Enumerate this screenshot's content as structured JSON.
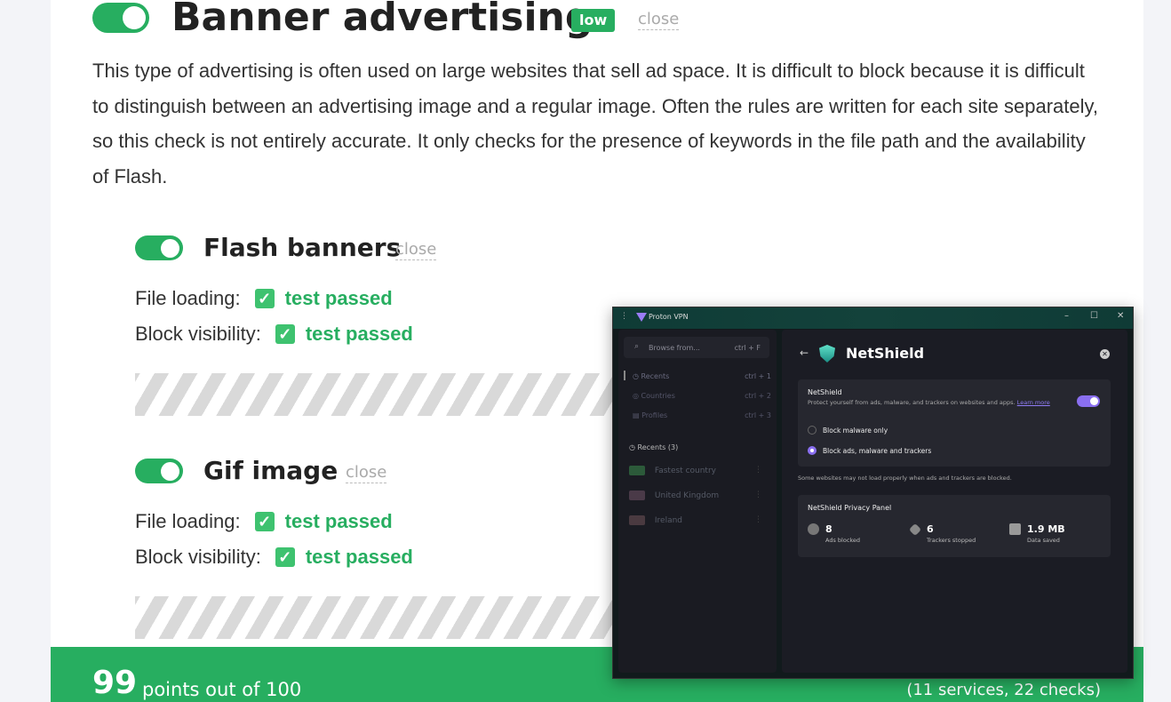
{
  "section": {
    "title": "Banner advertising",
    "badge": "low",
    "close_label": "close",
    "description": "This type of advertising is often used on large websites that sell ad space. It is difficult to block because it is difficult to distinguish between an advertising image and a regular image. Often the rules are written for each site separately, so this check is not entirely accurate. It only checks for the presence of keywords in the file path and the availability of Flash."
  },
  "tests": [
    {
      "title": "Flash banners",
      "close_label": "close",
      "rows": [
        {
          "label": "File loading:",
          "result": "test passed"
        },
        {
          "label": "Block visibility:",
          "result": "test passed"
        }
      ]
    },
    {
      "title": "Gif image",
      "close_label": "close",
      "rows": [
        {
          "label": "File loading:",
          "result": "test passed"
        },
        {
          "label": "Block visibility:",
          "result": "test passed"
        }
      ]
    }
  ],
  "footer": {
    "score": "99",
    "score_text": "points out of 100",
    "summary": "(11 services, 22 checks)"
  },
  "vpn": {
    "app_title": "Proton VPN",
    "window_controls": [
      "–",
      "☐",
      "✕"
    ],
    "search_placeholder": "Browse from...",
    "search_shortcut": "ctrl + F",
    "nav": [
      {
        "label": "Recents",
        "shortcut": "ctrl + 1"
      },
      {
        "label": "Countries",
        "shortcut": "ctrl + 2"
      },
      {
        "label": "Profiles",
        "shortcut": "ctrl + 3"
      }
    ],
    "recents_heading": "Recents (3)",
    "recents": [
      "Fastest country",
      "United Kingdom",
      "Ireland"
    ],
    "panel_title": "NetShield",
    "netshield_label": "NetShield",
    "netshield_desc": "Protect yourself from ads, malware, and trackers on websites and apps.",
    "learn_more": "Learn more",
    "options": [
      "Block malware only",
      "Block ads, malware and trackers"
    ],
    "note": "Some websites may not load properly when ads and trackers are blocked.",
    "privacy_panel_title": "NetShield Privacy Panel",
    "stats": [
      {
        "value": "8",
        "label": "Ads blocked"
      },
      {
        "value": "6",
        "label": "Trackers stopped"
      },
      {
        "value": "1.9 MB",
        "label": "Data saved"
      }
    ]
  },
  "colors": {
    "accent_green": "#27ae60",
    "vpn_accent": "#8a6ff0"
  }
}
